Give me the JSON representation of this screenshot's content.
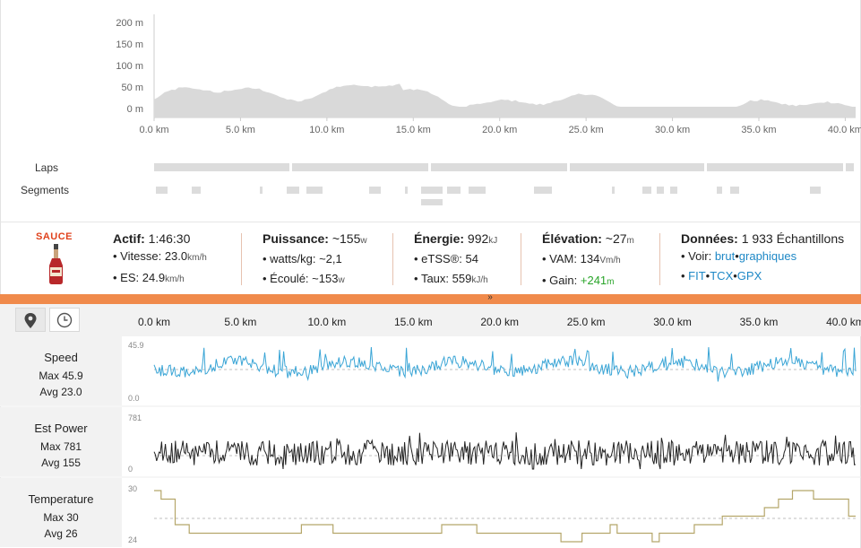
{
  "elevation_chart": {
    "y_ticks": [
      "200 m",
      "150 m",
      "100 m",
      "50 m",
      "0 m"
    ],
    "x_ticks": [
      "0.0 km",
      "5.0 km",
      "10.0 km",
      "15.0 km",
      "20.0 km",
      "25.0 km",
      "30.0 km",
      "35.0 km",
      "40.0 km"
    ],
    "fill_color": "#d9d9d9"
  },
  "laps_label": "Laps",
  "segments_label": "Segments",
  "summary": {
    "logo_text": "SAUCE",
    "actif": {
      "label": "Actif:",
      "value": "1:46:30",
      "vitesse_label": "Vitesse:",
      "vitesse_value": "23.0",
      "vitesse_unit": "km/h",
      "es_label": "ES:",
      "es_value": "24.9",
      "es_unit": "km/h"
    },
    "puissance": {
      "label": "Puissance:",
      "value": "~155",
      "unit": "w",
      "wkg_label": "watts/kg:",
      "wkg_value": "~2,1",
      "ecoule_label": "Écoulé:",
      "ecoule_value": "~153",
      "ecoule_unit": "w"
    },
    "energie": {
      "label": "Énergie:",
      "value": "992",
      "unit": "kJ",
      "etss_label": "eTSS®:",
      "etss_value": "54",
      "taux_label": "Taux:",
      "taux_value": "559",
      "taux_unit": "kJ/h"
    },
    "elevation": {
      "label": "Élévation:",
      "value": "~27",
      "unit": "m",
      "vam_label": "VAM:",
      "vam_value": "134",
      "vam_unit": "Vm/h",
      "gain_label": "Gain:",
      "gain_value": "+241",
      "gain_unit": "m"
    },
    "donnees": {
      "label": "Données:",
      "value": "1 933 Échantillons",
      "voir_label": "Voir:",
      "brut": "brut",
      "graphiques": "graphiques",
      "fit": "FIT",
      "tcx": "TCX",
      "gpx": "GPX"
    }
  },
  "expander_glyph": "»",
  "stream_x_ticks": [
    "0.0 km",
    "5.0 km",
    "10.0 km",
    "15.0 km",
    "20.0 km",
    "25.0 km",
    "30.0 km",
    "35.0 km",
    "40.0 km"
  ],
  "streams": [
    {
      "name": "Speed",
      "max": "Max 45.9",
      "avg": "Avg 23.0",
      "top_tick": "45.9",
      "bottom_tick": "0.0",
      "color": "#3aa5d6"
    },
    {
      "name": "Est Power",
      "max": "Max 781",
      "avg": "Avg 155",
      "top_tick": "781",
      "bottom_tick": "0",
      "color": "#222222"
    },
    {
      "name": "Temperature",
      "max": "Max 30",
      "avg": "Avg 26",
      "top_tick": "30",
      "bottom_tick": "24",
      "color": "#b5a66a"
    }
  ],
  "colors": {
    "accent": "#f08a4b",
    "link": "#1e88c6",
    "gain": "#2aa52a",
    "logo": "#e0421d"
  }
}
